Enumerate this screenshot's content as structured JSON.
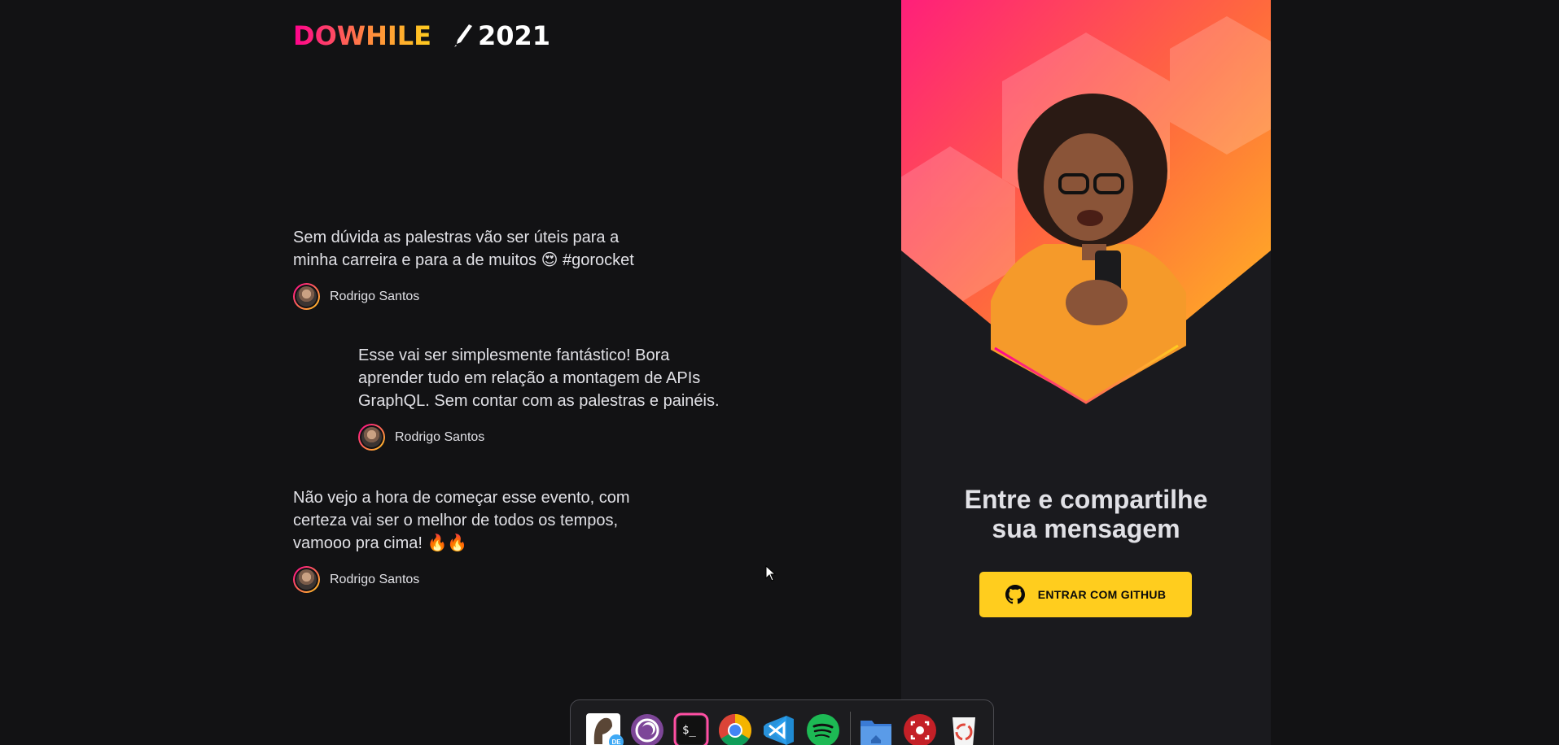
{
  "logo": {
    "text_do": "DO",
    "text_while": "WHILE",
    "year": "2021"
  },
  "messages": [
    {
      "content": "Sem dúvida as palestras vão ser úteis para a minha carreira e para a de muitos 😍 #gorocket",
      "author": "Rodrigo Santos"
    },
    {
      "content": "Esse vai ser simplesmente fantástico! Bora aprender tudo em relação a montagem de APIs GraphQL. Sem contar com as palestras e painéis.",
      "author": "Rodrigo Santos"
    },
    {
      "content": "Não vejo a hora de começar esse evento, com certeza vai ser o melhor de todos os tempos, vamooo pra cima! 🔥🔥",
      "author": "Rodrigo Santos"
    }
  ],
  "login_box": {
    "title_line1": "Entre e compartilhe",
    "title_line2": "sua mensagem",
    "button_label": "ENTRAR COM GITHUB"
  },
  "dock": {
    "items": [
      "dbeaver-icon",
      "tor-browser-icon",
      "terminal-icon",
      "chrome-icon",
      "vscode-icon",
      "spotify-icon",
      "files-icon",
      "screen-recorder-icon",
      "recycle-icon"
    ],
    "dbeaver_tag": "DE"
  },
  "colors": {
    "background": "#121214",
    "panel": "#1a1a1e",
    "accent_pink": "#ff008e",
    "accent_orange": "#ff8a3d",
    "accent_yellow": "#ffcd1e",
    "text": "#e1e1e6"
  }
}
